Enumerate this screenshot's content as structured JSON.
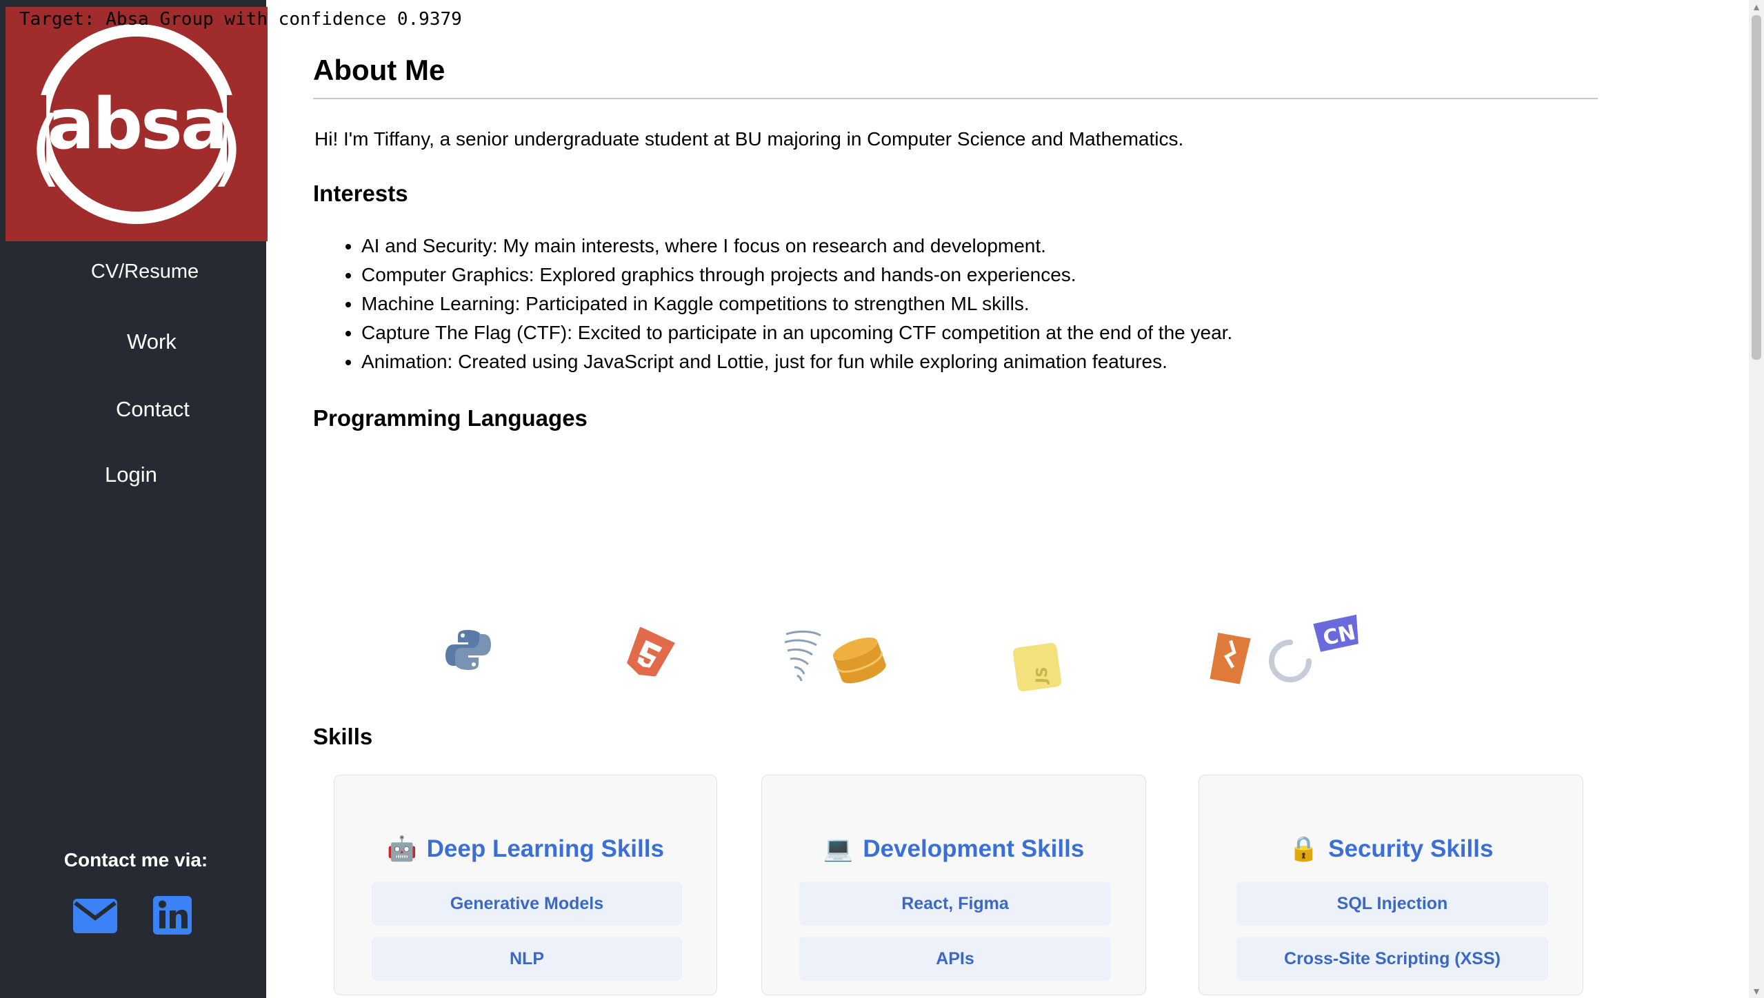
{
  "overlay": {
    "target_text": "Target: Absa Group with confidence 0.9379"
  },
  "brand": {
    "logo_text": "absa",
    "logo_bg": "#a02c2c"
  },
  "sidebar": {
    "title": "CV/Resume",
    "buttons": [
      {
        "label": "Work"
      },
      {
        "label": "Contact"
      },
      {
        "label": "Login"
      }
    ],
    "contact_title": "Contact me via:",
    "contact_icons": [
      "mail-icon",
      "linkedin-icon"
    ]
  },
  "main": {
    "heading": "About Me",
    "intro": "Hi! I'm Tiffany, a senior undergraduate student at BU majoring in Computer Science and Mathematics.",
    "interests_heading": "Interests",
    "interests": [
      "AI and Security: My main interests, where I focus on research and development.",
      "Computer Graphics: Explored graphics through projects and hands-on experiences.",
      "Machine Learning: Participated in Kaggle competitions to strengthen ML skills.",
      "Capture The Flag (CTF): Excited to participate in an upcoming CTF competition at the end of the year.",
      "Animation: Created using JavaScript and Lottie, just for fun while exploring animation features."
    ],
    "languages_heading": "Programming Languages",
    "language_icons": [
      "python-icon",
      "html5-icon",
      "sqlalchemy-icon",
      "database-icon",
      "javascript-icon",
      "git-icon",
      "spinner-icon",
      "cn-icon"
    ],
    "skills_heading": "Skills",
    "skill_cards": [
      {
        "emoji": "🤖",
        "title": "Deep Learning Skills",
        "items": [
          "Generative Models",
          "NLP"
        ]
      },
      {
        "emoji": "💻",
        "title": "Development Skills",
        "items": [
          "React, Figma",
          "APIs"
        ]
      },
      {
        "emoji": "🔒",
        "title": "Security Skills",
        "items": [
          "SQL Injection",
          "Cross-Site Scripting (XSS)"
        ]
      }
    ]
  },
  "colors": {
    "sidebar_bg": "#262b33",
    "accent_blue": "#3a6fd8",
    "pill_bg": "#edf1fa"
  }
}
